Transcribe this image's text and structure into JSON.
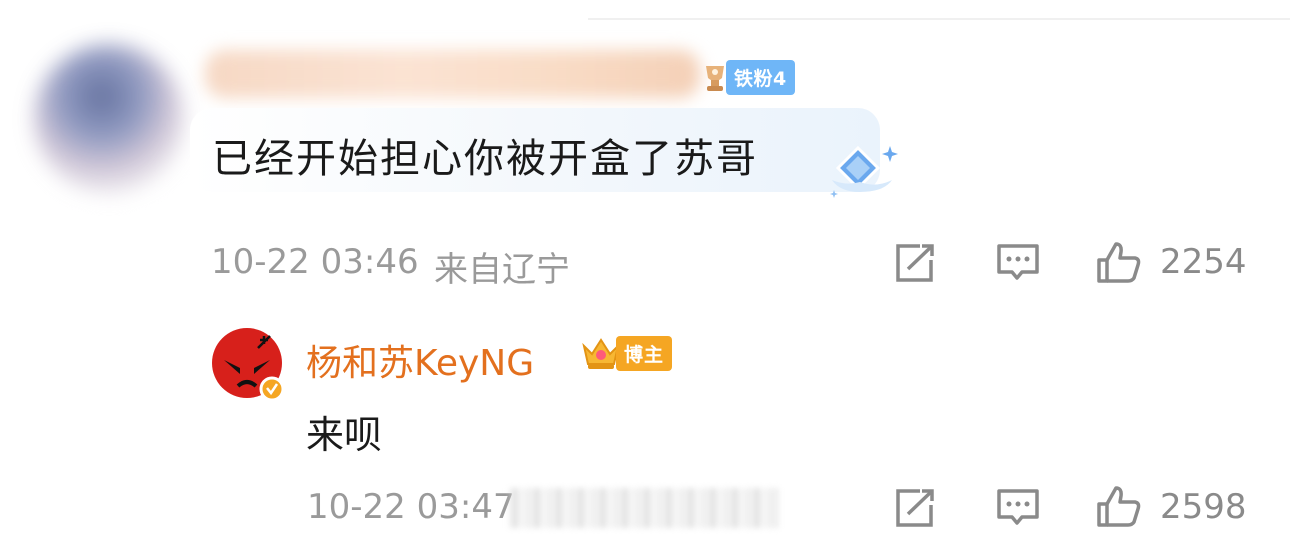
{
  "comment": {
    "fan_badge": "铁粉4",
    "text": "已经开始担心你被开盒了苏哥",
    "timestamp": "10-22 03:46",
    "location": "来自辽宁",
    "likes": "2254"
  },
  "reply": {
    "username": "杨和苏KeyNG",
    "host_badge": "博主",
    "text": "来呗",
    "timestamp": "10-22 03:47",
    "likes": "2598"
  },
  "colors": {
    "username_orange": "#e3701e",
    "fan_badge_blue": "#6fb6f7",
    "host_badge_gold": "#f5a623",
    "meta_gray": "#9a9a9a"
  },
  "icons": [
    "repost-icon",
    "comment-icon",
    "like-icon",
    "verified-icon",
    "crown-icon",
    "diamond-icon"
  ]
}
